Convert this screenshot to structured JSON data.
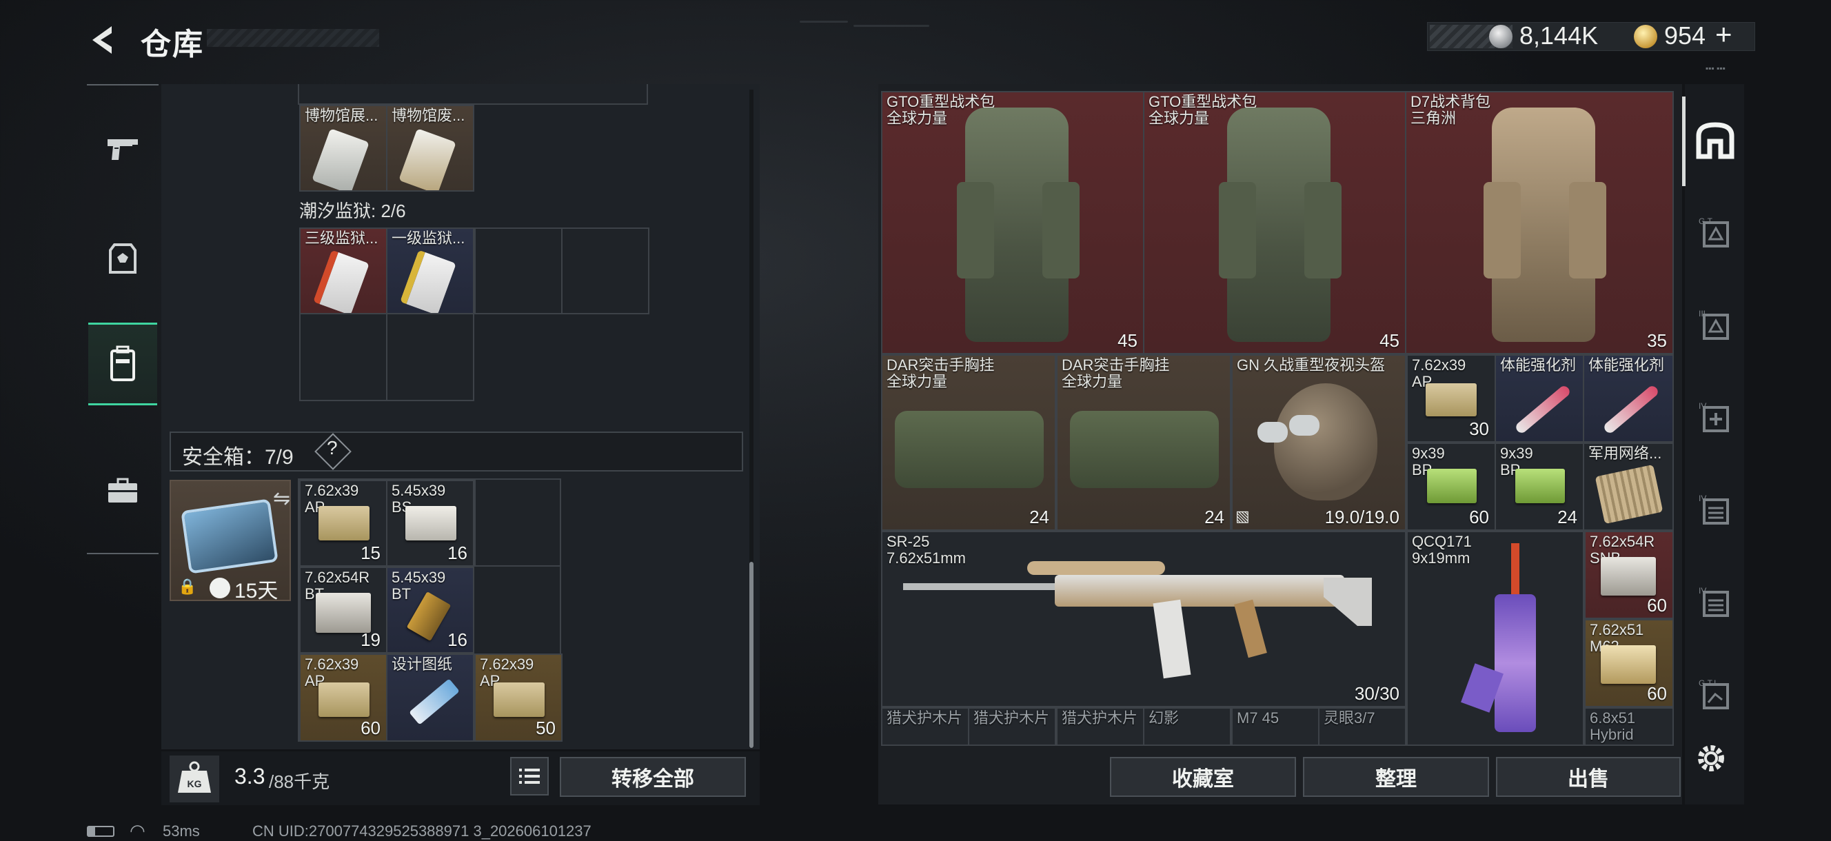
{
  "header": {
    "title": "仓库",
    "silver_amount": "8,144K",
    "gold_amount": "954",
    "gold_plus": "+"
  },
  "left_nav": [
    "weapon",
    "gear",
    "backpack",
    "toolbox"
  ],
  "left_panel": {
    "museum_items": [
      "博物馆展...",
      "博物馆废..."
    ],
    "prison_label": "潮汐监狱: 2/6",
    "prison_items": [
      "三级监狱...",
      "一级监狱..."
    ],
    "safe_box_label": "安全箱：7/9",
    "safe_box_help": "?",
    "safe_box_timer": "15天",
    "safe_items": [
      {
        "label": "7.62x39\nAP",
        "count": "15"
      },
      {
        "label": "5.45x39\nBS",
        "count": "16"
      },
      {
        "label": "7.62x54R\nBT",
        "count": "19"
      },
      {
        "label": "5.45x39\nBT",
        "count": "16"
      },
      {
        "label": "7.62x39\nAP",
        "count": "60"
      },
      {
        "label": "设计图纸",
        "count": ""
      },
      {
        "label": "7.62x39\nAP",
        "count": "50"
      }
    ],
    "weight_value": "3.3",
    "weight_unit": "/88千克",
    "transfer_all": "转移全部"
  },
  "right_panel": {
    "bags": [
      {
        "name": "GTO重型战术包",
        "sub": "全球力量",
        "count": "45"
      },
      {
        "name": "GTO重型战术包",
        "sub": "全球力量",
        "count": "45"
      },
      {
        "name": "D7战术背包",
        "sub": "三角洲",
        "count": "35"
      }
    ],
    "rigs": [
      {
        "name": "DAR突击手胸挂",
        "sub": "全球力量",
        "count": "24"
      },
      {
        "name": "DAR突击手胸挂",
        "sub": "全球力量",
        "count": "24"
      }
    ],
    "helmet": {
      "name": "GN 久战重型夜视头盔",
      "durability": "19.0/19.0"
    },
    "small_items": [
      {
        "label": "7.62x39\nAP",
        "count": "30"
      },
      {
        "label": "体能强化剂",
        "count": ""
      },
      {
        "label": "体能强化剂",
        "count": ""
      },
      {
        "label": "9x39\nBP",
        "count": "60"
      },
      {
        "label": "9x39\nBP",
        "count": "24"
      },
      {
        "label": "军用网络...",
        "count": ""
      }
    ],
    "sr25": {
      "name": "SR-25",
      "caliber": "7.62x51mm",
      "ammo": "30/30"
    },
    "qcq171": {
      "name": "QCQ171",
      "caliber": "9x19mm"
    },
    "ammo_right": [
      {
        "label": "7.62x54R\nSNB",
        "count": "60"
      },
      {
        "label": "7.62x51\nM62",
        "count": "60"
      },
      {
        "label": "6.8x51\nHybrid",
        "count": ""
      }
    ],
    "bottom_row": [
      "猎犬护木片",
      "猎犬护木片",
      "猎犬护木片",
      "幻影",
      "M7 45",
      "灵眼3/7"
    ],
    "buttons": {
      "collection": "收藏室",
      "sort": "整理",
      "sell": "出售"
    }
  },
  "footer": {
    "ping": "53ms",
    "uid": "CN UID:2700774329525388971 3_202606101237"
  }
}
